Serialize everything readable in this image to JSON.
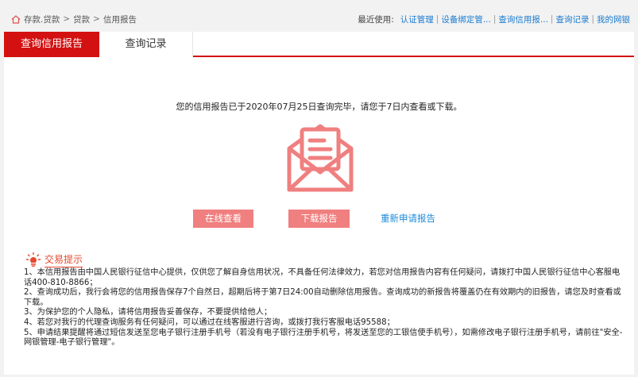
{
  "breadcrumb": {
    "items": [
      "存款.贷款",
      "贷款",
      "信用报告"
    ],
    "separator": ">"
  },
  "recent": {
    "label": "最近使用:",
    "links": [
      "认证管理",
      "设备绑定管...",
      "查询信用报...",
      "查询记录",
      "我的网银"
    ]
  },
  "tabs": {
    "active": "查询信用报告",
    "inactive": "查询记录"
  },
  "notice": "您的信用报告已于2020年07月25日查询完毕，请您于7日内查看或下载。",
  "buttons": {
    "online": "在线查看",
    "download": "下载报告",
    "reapply": "重新申请报告"
  },
  "tips": {
    "title": "交易提示",
    "items": [
      "1、本信用报告由中国人民银行征信中心提供，仅供您了解自身信用状况，不具备任何法律效力，若您对信用报告内容有任何疑问，请拨打中国人民银行征信中心客服电话400-810-8866；",
      "2、查询成功后，我行会将您的信用报告保存7个自然日，超期后将于第7日24:00自动删除信用报告。查询成功的新报告将覆盖仍在有效期内的旧报告，请您及时查看或下载。",
      "3、为保护您的个人隐私，请将信用报告妥善保存，不要提供给他人；",
      "4、若您对我行的代理查询服务有任何疑问，可以通过在线客服进行咨询，或拨打我行客服电话95588；",
      "5、申请结果提醒将通过短信发送至您电子银行注册手机号（若没有电子银行注册手机号，将发送至您的工银信使手机号），如需修改电子银行注册手机号，请前往\"安全-网银管理-电子银行管理\"。"
    ]
  },
  "colors": {
    "brand_red": "#d31111",
    "button_pink": "#f07f7f",
    "link_blue": "#1a7bd0",
    "tip_orange": "#e5482e"
  }
}
